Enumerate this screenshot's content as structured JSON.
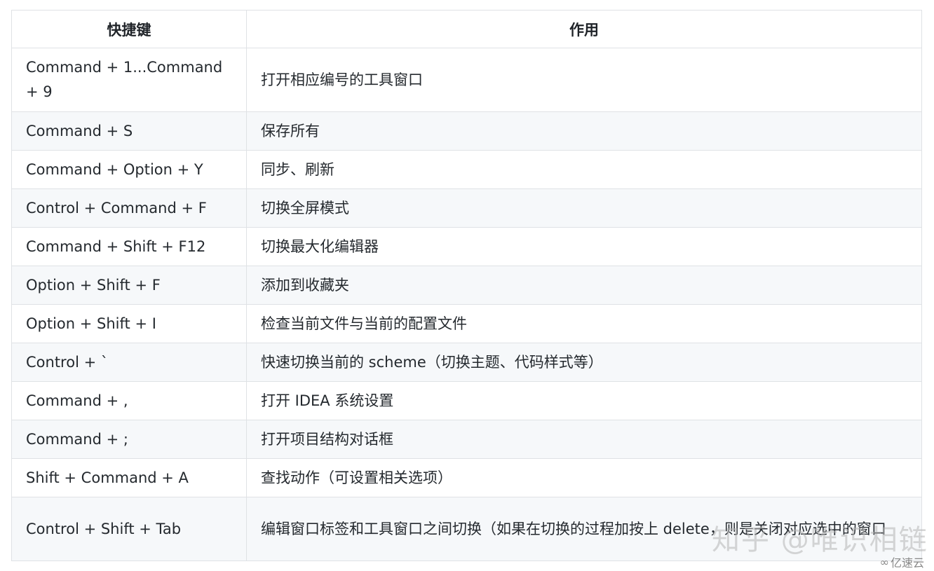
{
  "table": {
    "headers": [
      "快捷键",
      "作用"
    ],
    "rows": [
      {
        "shortcut": "Command + 1...Command + 9",
        "action": "打开相应编号的工具窗口"
      },
      {
        "shortcut": "Command + S",
        "action": "保存所有"
      },
      {
        "shortcut": "Command + Option + Y",
        "action": "同步、刷新"
      },
      {
        "shortcut": "Control + Command + F",
        "action": "切换全屏模式"
      },
      {
        "shortcut": "Command + Shift + F12",
        "action": "切换最大化编辑器"
      },
      {
        "shortcut": "Option + Shift + F",
        "action": "添加到收藏夹"
      },
      {
        "shortcut": "Option + Shift + I",
        "action": "检查当前文件与当前的配置文件"
      },
      {
        "shortcut": "Control + `",
        "action": "快速切换当前的 scheme（切换主题、代码样式等）"
      },
      {
        "shortcut": "Command + ,",
        "action": "打开 IDEA 系统设置"
      },
      {
        "shortcut": "Command + ;",
        "action": "打开项目结构对话框"
      },
      {
        "shortcut": "Shift + Command + A",
        "action": "查找动作（可设置相关选项）"
      },
      {
        "shortcut": "Control + Shift + Tab",
        "action": "编辑窗口标签和工具窗口之间切换（如果在切换的过程加按上 delete，则是关闭对应选中的窗口"
      }
    ]
  },
  "watermark": "知乎 @唯识相链",
  "logo": {
    "icon": "cloud-logo-icon",
    "text": "亿速云"
  }
}
